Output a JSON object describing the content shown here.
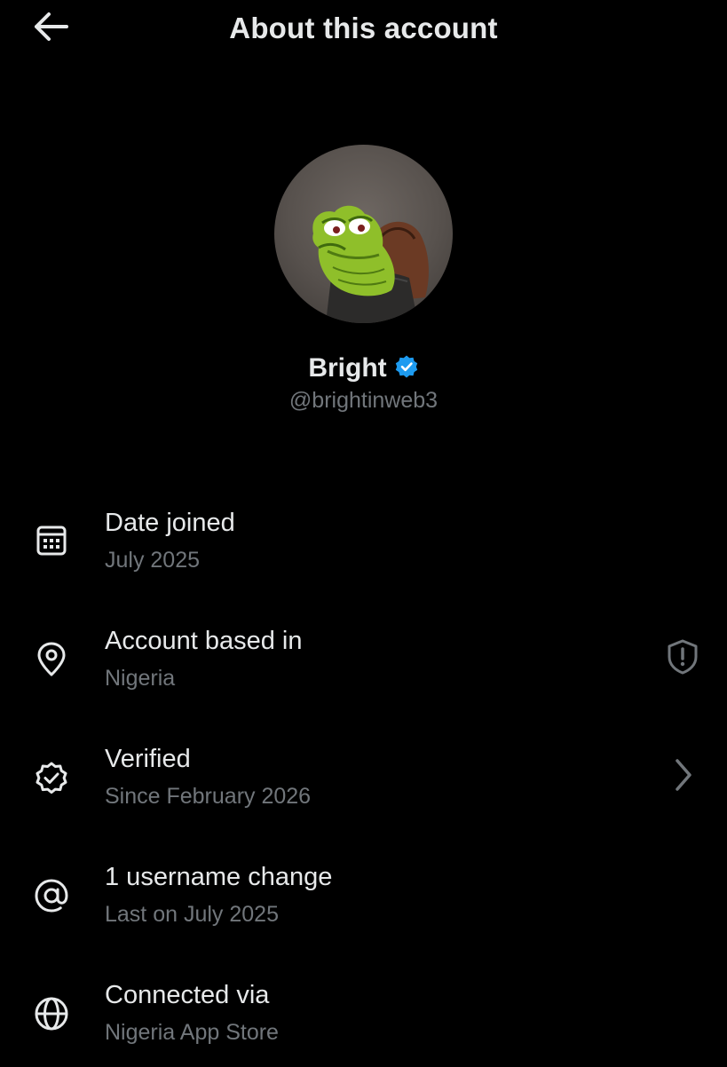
{
  "header": {
    "title": "About this account",
    "back_icon": "arrow-left-icon"
  },
  "profile": {
    "display_name": "Bright",
    "handle": "@brightinweb3",
    "verified_badge_color": "#1d9bf0",
    "avatar_icon": "pepe-avatar"
  },
  "items": [
    {
      "icon": "calendar-icon",
      "title": "Date joined",
      "subtitle": "July 2025"
    },
    {
      "icon": "location-pin-icon",
      "title": "Account based in",
      "subtitle": "Nigeria",
      "action_icon": "shield-alert-icon"
    },
    {
      "icon": "verified-check-icon",
      "title": "Verified",
      "subtitle": "Since February 2026",
      "action_icon": "chevron-right-icon"
    },
    {
      "icon": "at-sign-icon",
      "title": "1 username change",
      "subtitle": "Last on July 2025"
    },
    {
      "icon": "globe-icon",
      "title": "Connected via",
      "subtitle": "Nigeria App Store"
    }
  ],
  "colors": {
    "background": "#000000",
    "primary_text": "#e7e9ea",
    "secondary_text": "#71767b",
    "accent": "#1d9bf0"
  }
}
